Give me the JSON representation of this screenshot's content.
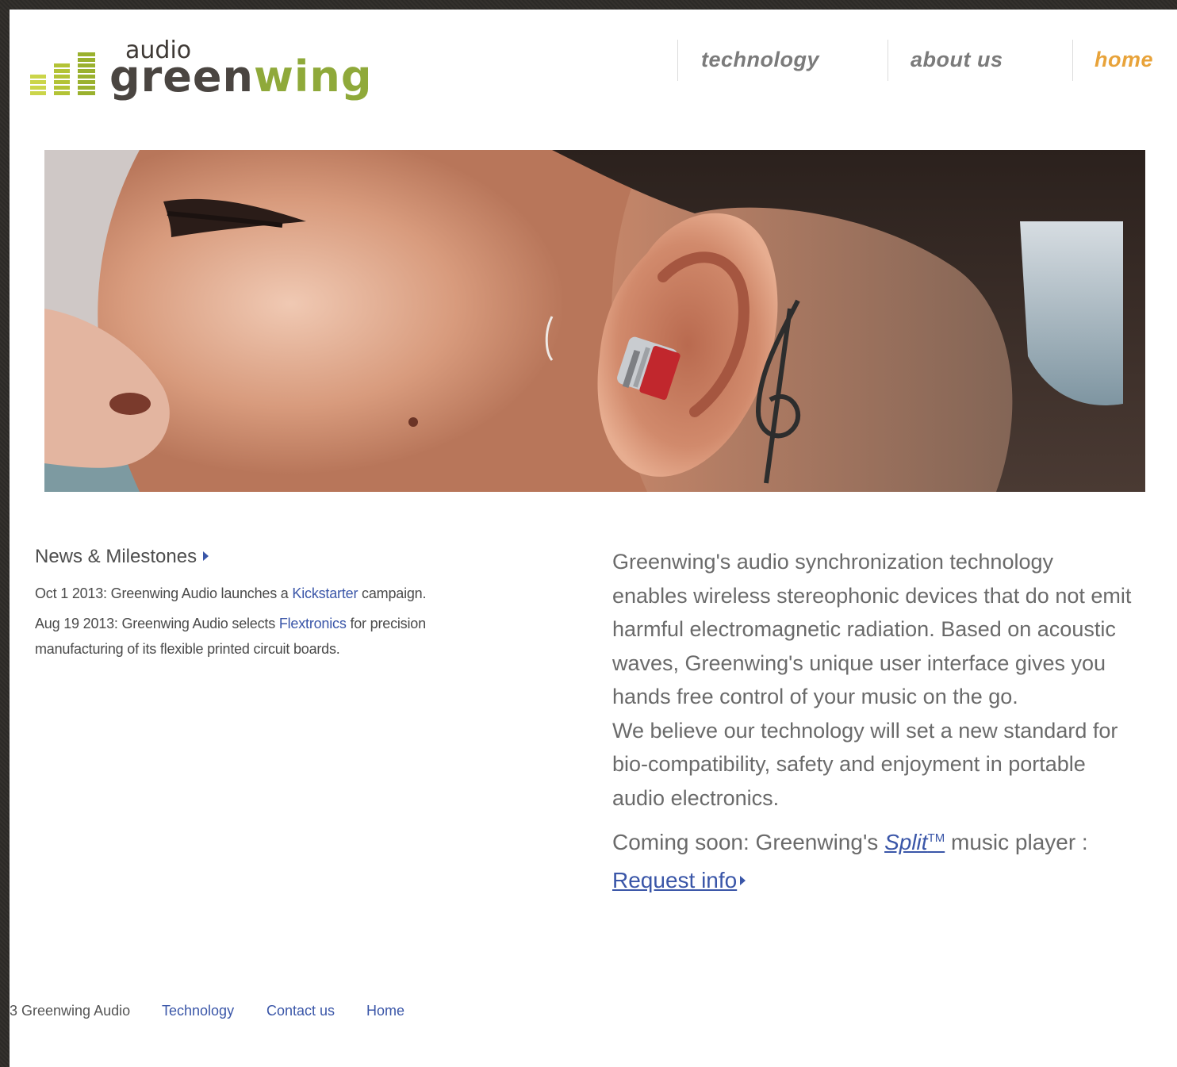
{
  "logo": {
    "top_word": "audio",
    "name_part1": "green",
    "name_part2": "wing",
    "colors": {
      "dark": "#4a4541",
      "green": "#8fa93a",
      "bar_yellow": "#cbd54a"
    }
  },
  "nav": {
    "items": [
      {
        "label": "technology",
        "active": false
      },
      {
        "label": "about us",
        "active": false
      },
      {
        "label": "home",
        "active": true
      }
    ],
    "active_color": "#e8a33a"
  },
  "hero": {
    "icon": "hero-photo-ear-earbud"
  },
  "news": {
    "title": "News & Milestones",
    "items": [
      {
        "before": "Oct 1 2013:  Greenwing Audio launches a ",
        "link": "Kickstarter",
        "after": " campaign."
      },
      {
        "before": "Aug 19 2013: Greenwing Audio selects ",
        "link": "Flextronics",
        "after": " for precision"
      },
      {
        "text": "manufacturing of its flexible  printed circuit boards."
      }
    ]
  },
  "body": {
    "lines": [
      "Greenwing's audio synchronization technology",
      "enables wireless stereophonic devices that do not emit",
      "harmful electromagnetic radiation. Based on acoustic",
      "waves, Greenwing's unique user interface gives you",
      "hands free control of your music on the go.",
      "We believe our technology will set a new standard for",
      "bio-compatibility, safety and enjoyment in portable",
      "audio electronics."
    ],
    "coming_before": "Coming soon: Greenwing's ",
    "split_label": "Split",
    "split_tm": "TM",
    "coming_after": " music player :",
    "request_label": "Request info"
  },
  "footer": {
    "copyright": "3 Greenwing Audio",
    "links": [
      "Technology",
      "Contact us",
      "Home"
    ]
  },
  "colors": {
    "link": "#3a56a8",
    "text_gray": "#6a6a6a"
  }
}
